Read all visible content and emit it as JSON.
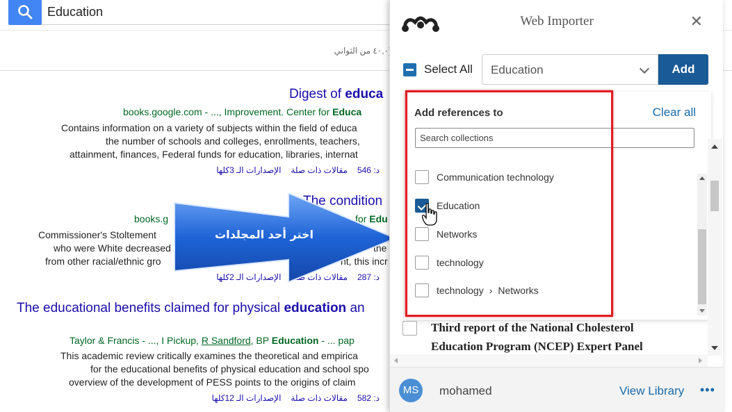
{
  "search": {
    "query": "Education"
  },
  "stats": "(٤٠,٠ من الثواني",
  "results": [
    {
      "title_pre": "Digest of ",
      "title_bold": "educa",
      "title_post": "",
      "meta_pre": "books.google.com - ..., Improvement. Center for ",
      "meta_bold": "Educa",
      "meta_author": "",
      "snippet": [
        "Contains information on a variety of subjects within the field of educa",
        "the number of schools and colleges, enrollments, teachers,",
        "attainment, finances, Federal funds for education, libraries, internat"
      ],
      "cited": "د: 546",
      "related": "مقالات ذات صلة",
      "versions": "الإصدارات الـ 3كلها"
    },
    {
      "title_pre": "The condition",
      "title_bold": "",
      "title_post": "",
      "meta_pre": "books.g",
      "meta_bold": "Edu",
      "meta_author": "for",
      "snippet": [
        "Commissioner's Stoltement",
        "who were White decreased",
        "from other racial/ethnic gro"
      ],
      "snippet_tail": [
        "the",
        "nt, this incr"
      ],
      "cited": "د: 287",
      "related": "مقالات ذات صلة",
      "versions": "الإصدارات الـ 2كلها"
    },
    {
      "title_pre": "The educational benefits claimed for physical ",
      "title_bold": "education",
      "title_post": " an",
      "meta_pre": "Taylor & Francis - ..., I Pickup, ",
      "meta_author": "R Sandford",
      "meta_mid": ", BP ",
      "meta_bold": "Education",
      "meta_post": " - ... pap",
      "snippet": [
        "This academic review critically examines the theoretical and empirica",
        "for the educational benefits of physical education and school spo",
        "overview of the development of PESS points to the origins of claim"
      ],
      "cited": "د: 582",
      "related": "مقالات ذات صلة",
      "versions": "الإصدارات الـ 12كلها"
    }
  ],
  "annotation": {
    "arrow_label": "اختر أحد المجلدات",
    "color": "#1e63d6"
  },
  "importer": {
    "title": "Web Importer",
    "select_all": "Select All",
    "collection": "Education",
    "add": "Add",
    "dropdown": {
      "header": "Add references to",
      "clear_all": "Clear all",
      "search_placeholder": "Search collections",
      "options": [
        {
          "label": "Communication technology",
          "checked": false
        },
        {
          "label": "Education",
          "checked": true
        },
        {
          "label": "Networks",
          "checked": false
        },
        {
          "label": "technology",
          "checked": false
        },
        {
          "label": "technology",
          "sub": "Networks",
          "checked": false
        }
      ]
    },
    "reference_title": "Third report of the National Cholesterol Education Program (NCEP) Expert Panel",
    "user": {
      "initials": "MS",
      "name": "mohamed"
    },
    "view_library": "View Library",
    "more": "•••",
    "colors": {
      "accent": "#1a5a96",
      "highlight": "#e11b22",
      "link": "#1a6aa8"
    }
  }
}
